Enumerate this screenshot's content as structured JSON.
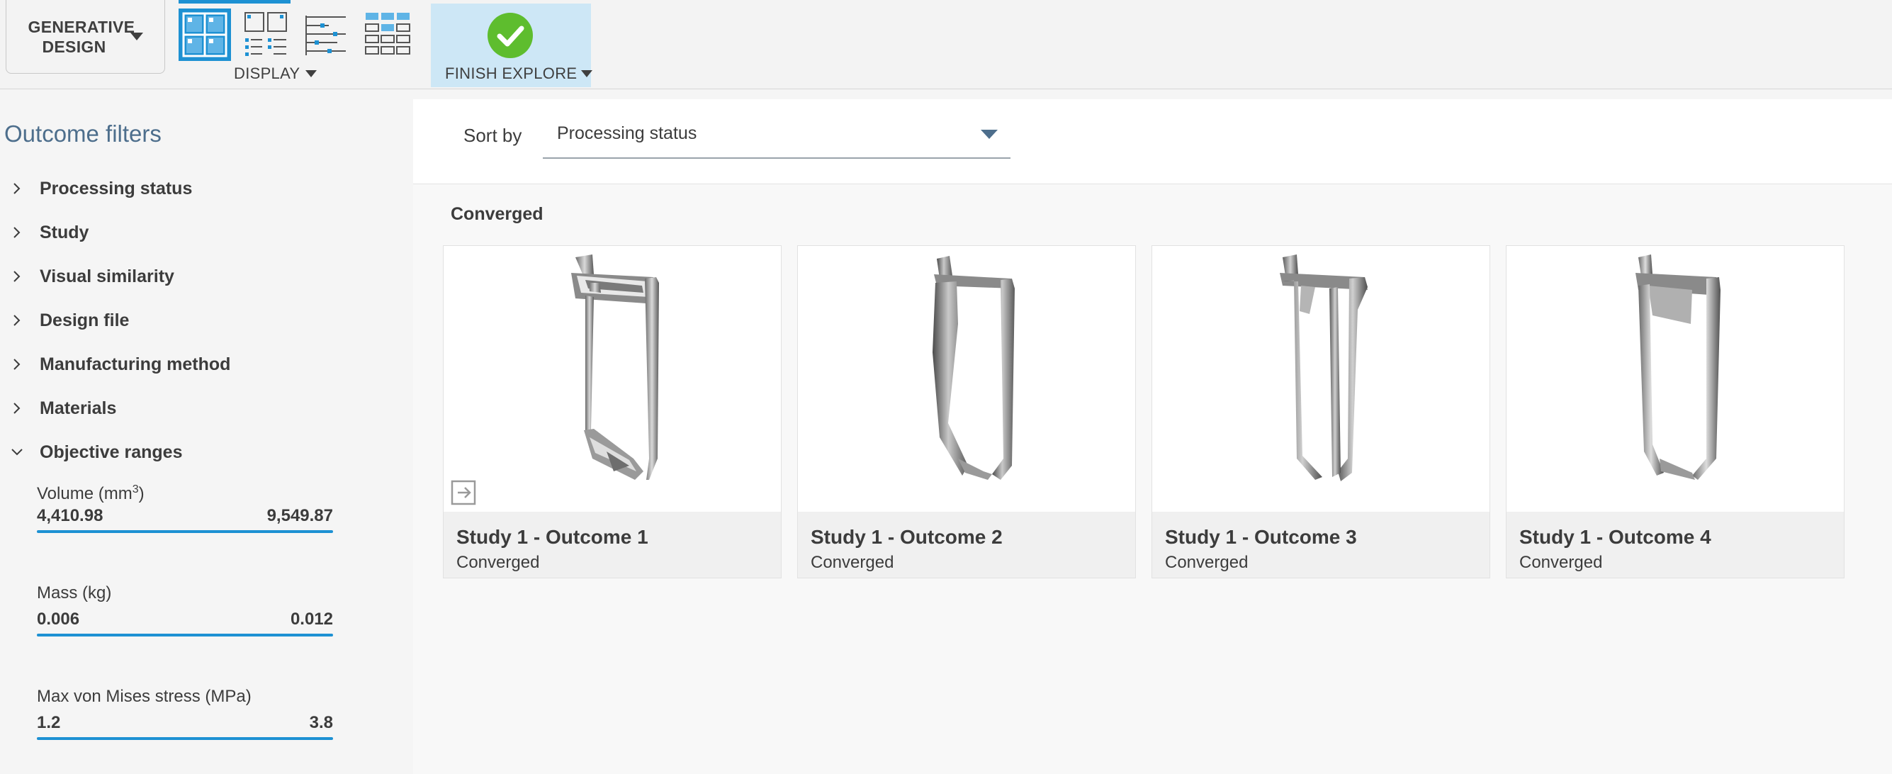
{
  "toolbar": {
    "workspace_label": "GENERATIVE DESIGN",
    "display_label": "DISPLAY",
    "finish_label": "FINISH EXPLORE",
    "accent_color": "#1d91d3",
    "finish_check_color": "#5ebd2e",
    "display_icons": [
      "thumbnail-grid-icon",
      "thumbnail-list-icon",
      "detail-list-icon",
      "table-grid-icon"
    ]
  },
  "sidebar": {
    "title": "Outcome filters",
    "filters": [
      {
        "label": "Processing status",
        "expanded": false
      },
      {
        "label": "Study",
        "expanded": false
      },
      {
        "label": "Visual similarity",
        "expanded": false
      },
      {
        "label": "Design file",
        "expanded": false
      },
      {
        "label": "Manufacturing method",
        "expanded": false
      },
      {
        "label": "Materials",
        "expanded": false
      },
      {
        "label": "Objective ranges",
        "expanded": true
      }
    ],
    "ranges": [
      {
        "label": "Volume (mm",
        "sup": "3",
        "label_end": ")",
        "min": "4,410.98",
        "max": "9,549.87"
      },
      {
        "label": "Mass (kg)",
        "sup": "",
        "label_end": "",
        "min": "0.006",
        "max": "0.012"
      },
      {
        "label": "Max von Mises stress (MPa)",
        "sup": "",
        "label_end": "",
        "min": "1.2",
        "max": "3.8"
      }
    ]
  },
  "main": {
    "sort_label": "Sort by",
    "sort_value": "Processing status",
    "group_title": "Converged",
    "outcomes": [
      {
        "title": "Study 1 - Outcome 1",
        "status": "Converged"
      },
      {
        "title": "Study 1 - Outcome 2",
        "status": "Converged"
      },
      {
        "title": "Study 1 - Outcome 3",
        "status": "Converged"
      },
      {
        "title": "Study 1 - Outcome 4",
        "status": "Converged"
      }
    ]
  }
}
